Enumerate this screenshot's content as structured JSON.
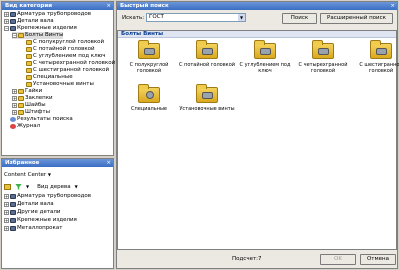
{
  "categories": {
    "title": "Вид категории",
    "close": "×",
    "items": [
      {
        "label": "Арматура трубопроводов",
        "level": 1,
        "exp": "+",
        "icon": "box"
      },
      {
        "label": "Детали вала",
        "level": 1,
        "exp": "+",
        "icon": "box"
      },
      {
        "label": "Крепежные изделия",
        "level": 1,
        "exp": "−",
        "icon": "box"
      },
      {
        "label": "Болты Винты",
        "level": 2,
        "exp": "−",
        "icon": "yel",
        "selected": true
      },
      {
        "label": "С полукруглой головкой",
        "level": 3,
        "icon": "yel"
      },
      {
        "label": "С потайной головкой",
        "level": 3,
        "icon": "yel"
      },
      {
        "label": "С углублением под ключ",
        "level": 3,
        "icon": "yel"
      },
      {
        "label": "С четырехгранной головкой",
        "level": 3,
        "icon": "yel"
      },
      {
        "label": "С шестигранной головкой",
        "level": 3,
        "icon": "yel"
      },
      {
        "label": "Специальные",
        "level": 3,
        "icon": "yel"
      },
      {
        "label": "Установочные винты",
        "level": 3,
        "icon": "yel"
      },
      {
        "label": "Гайки",
        "level": 2,
        "exp": "+",
        "icon": "yel"
      },
      {
        "label": "Заклепки",
        "level": 2,
        "exp": "+",
        "icon": "yel"
      },
      {
        "label": "Шайбы",
        "level": 2,
        "exp": "+",
        "icon": "yel"
      },
      {
        "label": "Штифты",
        "level": 2,
        "exp": "+",
        "icon": "yel"
      },
      {
        "label": "Результаты поиска",
        "level": 1,
        "icon": "blue"
      },
      {
        "label": "Журнал",
        "level": 1,
        "icon": "red"
      }
    ]
  },
  "favorites": {
    "title": "Избранное",
    "close": "×",
    "dropdown": "Content Center",
    "view_label": "Вид дерева",
    "items": [
      {
        "label": "Арматура трубопроводов",
        "exp": "+"
      },
      {
        "label": "Детали вала",
        "exp": "+"
      },
      {
        "label": "Другие детали",
        "exp": "+"
      },
      {
        "label": "Крепежные изделия",
        "exp": "+"
      },
      {
        "label": "Металлопрокат",
        "exp": "+"
      }
    ]
  },
  "quick_search": {
    "title": "Быстрый поиск",
    "close": "×",
    "label": "Искать:",
    "value": "ГОСТ",
    "search_button": "Поиск",
    "advanced_button": "Расширенный поиск"
  },
  "results": {
    "header": "Болты Винты",
    "items": [
      {
        "label": "С полукруглой головкой",
        "icon": "folder"
      },
      {
        "label": "С потайной головкой",
        "icon": "folder"
      },
      {
        "label": "С углублением под ключ",
        "icon": "folder"
      },
      {
        "label": "С четырехгранной головкой",
        "icon": "folder"
      },
      {
        "label": "С шестигранной головкой",
        "icon": "folder"
      },
      {
        "label": "Специальные",
        "icon": "folder"
      },
      {
        "label": "Установочные винты",
        "icon": "folder"
      }
    ]
  },
  "footer": {
    "count": "Подсчет:7",
    "ok": "OK",
    "cancel": "Отмена"
  }
}
